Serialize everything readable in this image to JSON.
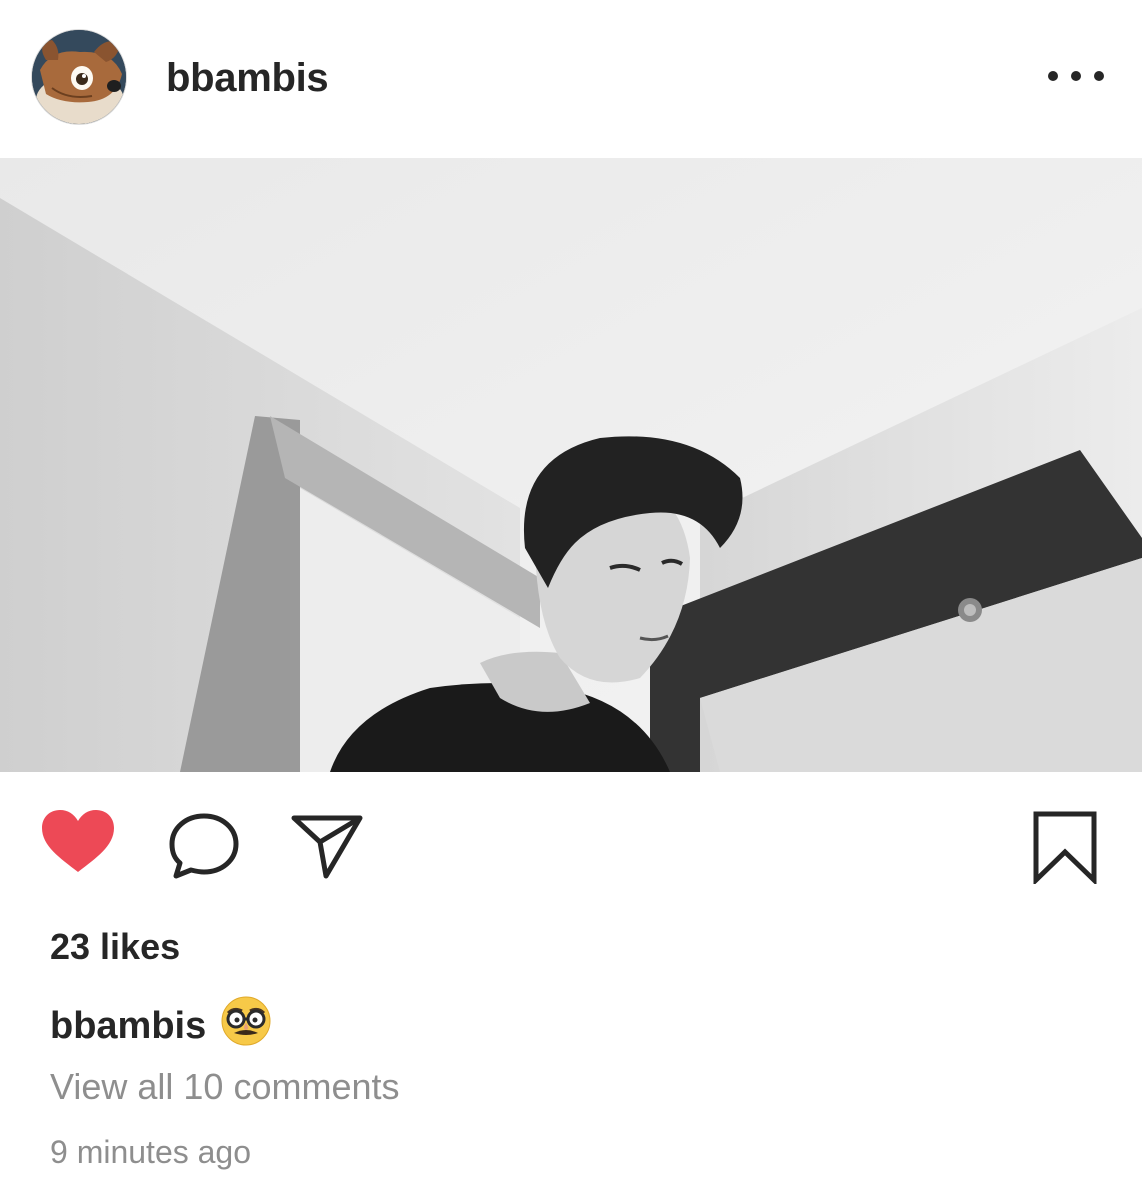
{
  "post": {
    "username": "bbambis",
    "avatar_icon": "deer-cartoon-avatar",
    "menu_icon": "more-options-icon",
    "photo_description_icon": "bw-selfie-photo",
    "actions": {
      "like_icon": "heart-filled-icon",
      "like_color": "#ed4956",
      "comment_icon": "comment-bubble-icon",
      "share_icon": "paper-plane-icon",
      "save_icon": "bookmark-icon"
    },
    "likes_text": "23 likes",
    "caption_username": "bbambis",
    "caption_emoji": "🥸",
    "view_comments_text": "View all 10 comments",
    "timestamp": "9 minutes ago"
  }
}
